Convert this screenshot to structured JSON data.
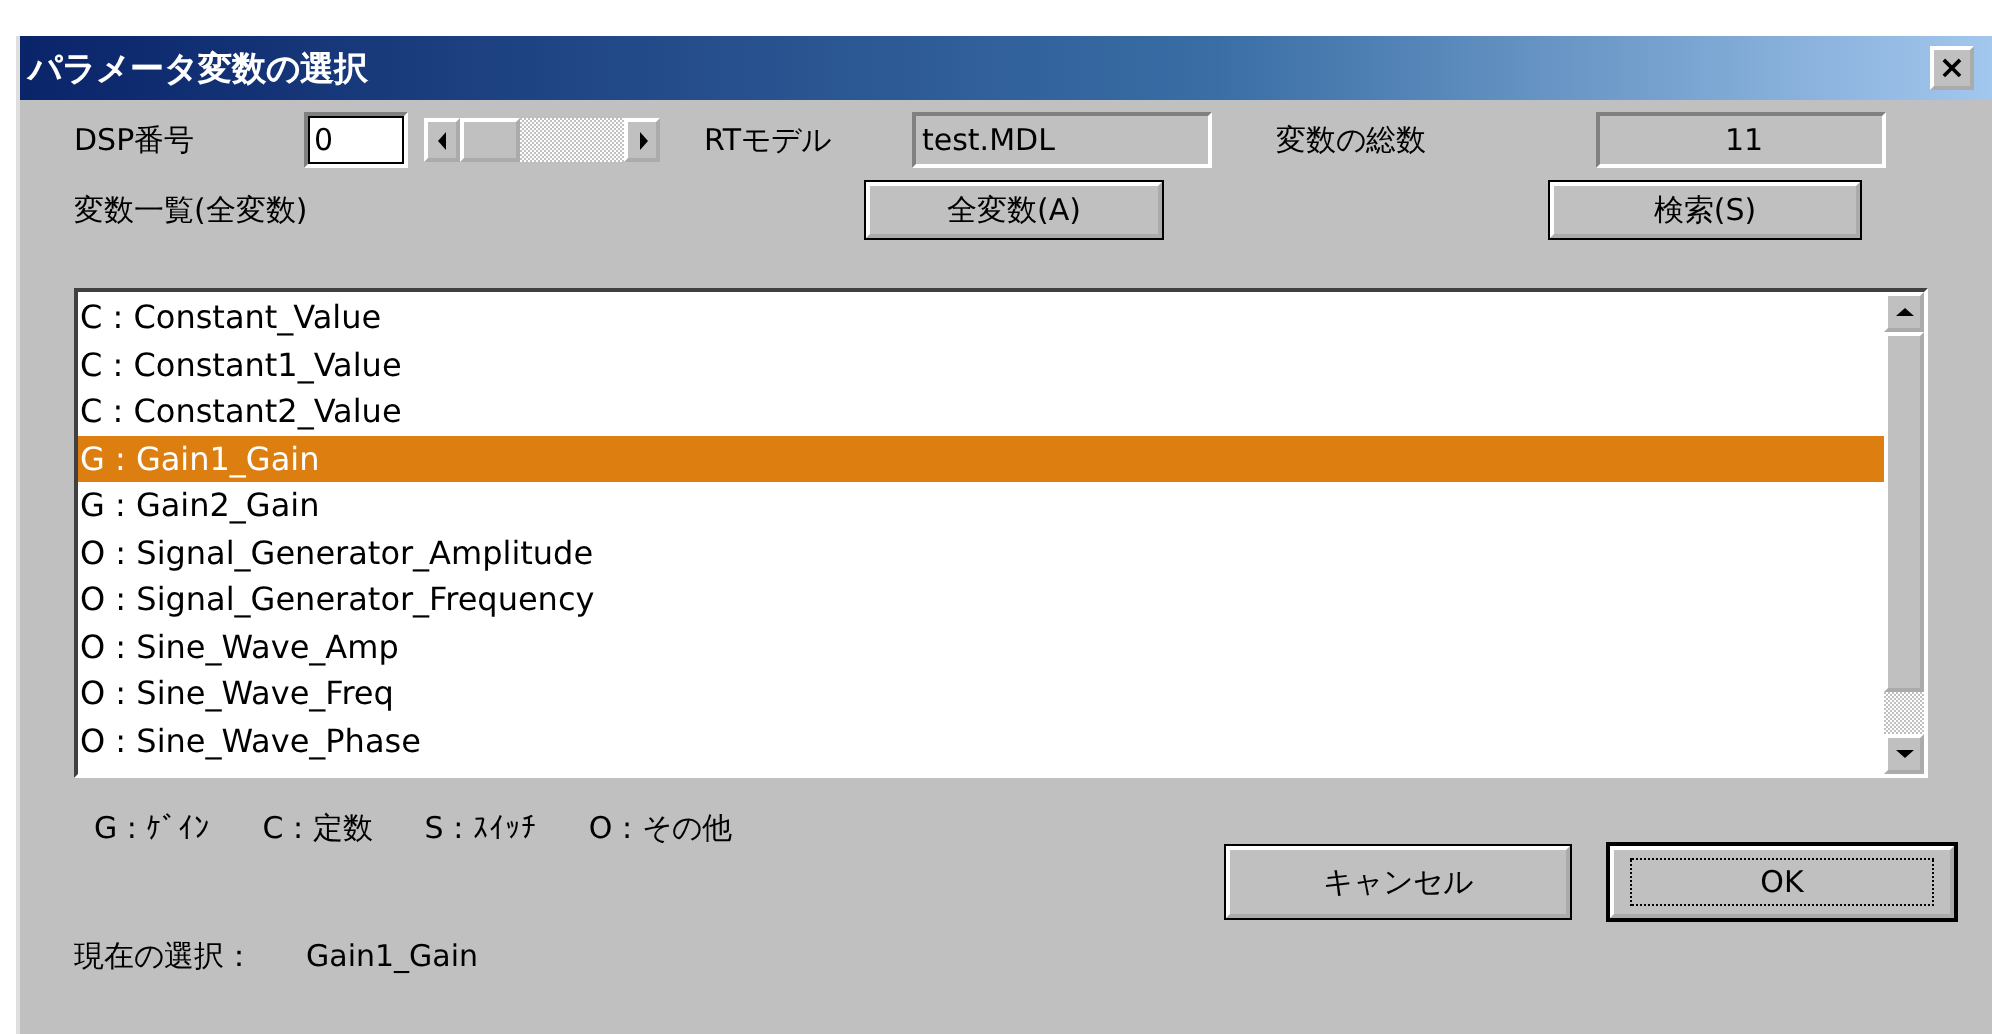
{
  "window": {
    "title": "パラメータ変数の選択",
    "close": "×"
  },
  "dsp": {
    "label": "DSP番号",
    "value": "0"
  },
  "model": {
    "label": "RTモデル",
    "value": "test.MDL"
  },
  "total": {
    "label": "変数の総数",
    "value": "11"
  },
  "list_label": "変数一覧(全変数)",
  "top_buttons": [
    "全変数(A)",
    "検索(S)"
  ],
  "variables": [
    {
      "text": "C : Constant_Value",
      "selected": false
    },
    {
      "text": "C : Constant1_Value",
      "selected": false
    },
    {
      "text": "C : Constant2_Value",
      "selected": false
    },
    {
      "text": "G : Gain1_Gain",
      "selected": true
    },
    {
      "text": "G : Gain2_Gain",
      "selected": false
    },
    {
      "text": "O : Signal_Generator_Amplitude",
      "selected": false
    },
    {
      "text": "O : Signal_Generator_Frequency",
      "selected": false
    },
    {
      "text": "O : Sine_Wave_Amp",
      "selected": false
    },
    {
      "text": "O : Sine_Wave_Freq",
      "selected": false
    },
    {
      "text": "O : Sine_Wave_Phase",
      "selected": false
    }
  ],
  "legend": [
    "G : ｹﾞｲﾝ",
    "C : 定数",
    "S : ｽｲｯﾁ",
    "O : その他"
  ],
  "buttons": [
    {
      "label": "キャンセル",
      "default": false
    },
    {
      "label": "OK",
      "default": true
    }
  ],
  "current": {
    "label": "現在の選択：",
    "value": "Gain1_Gain"
  }
}
